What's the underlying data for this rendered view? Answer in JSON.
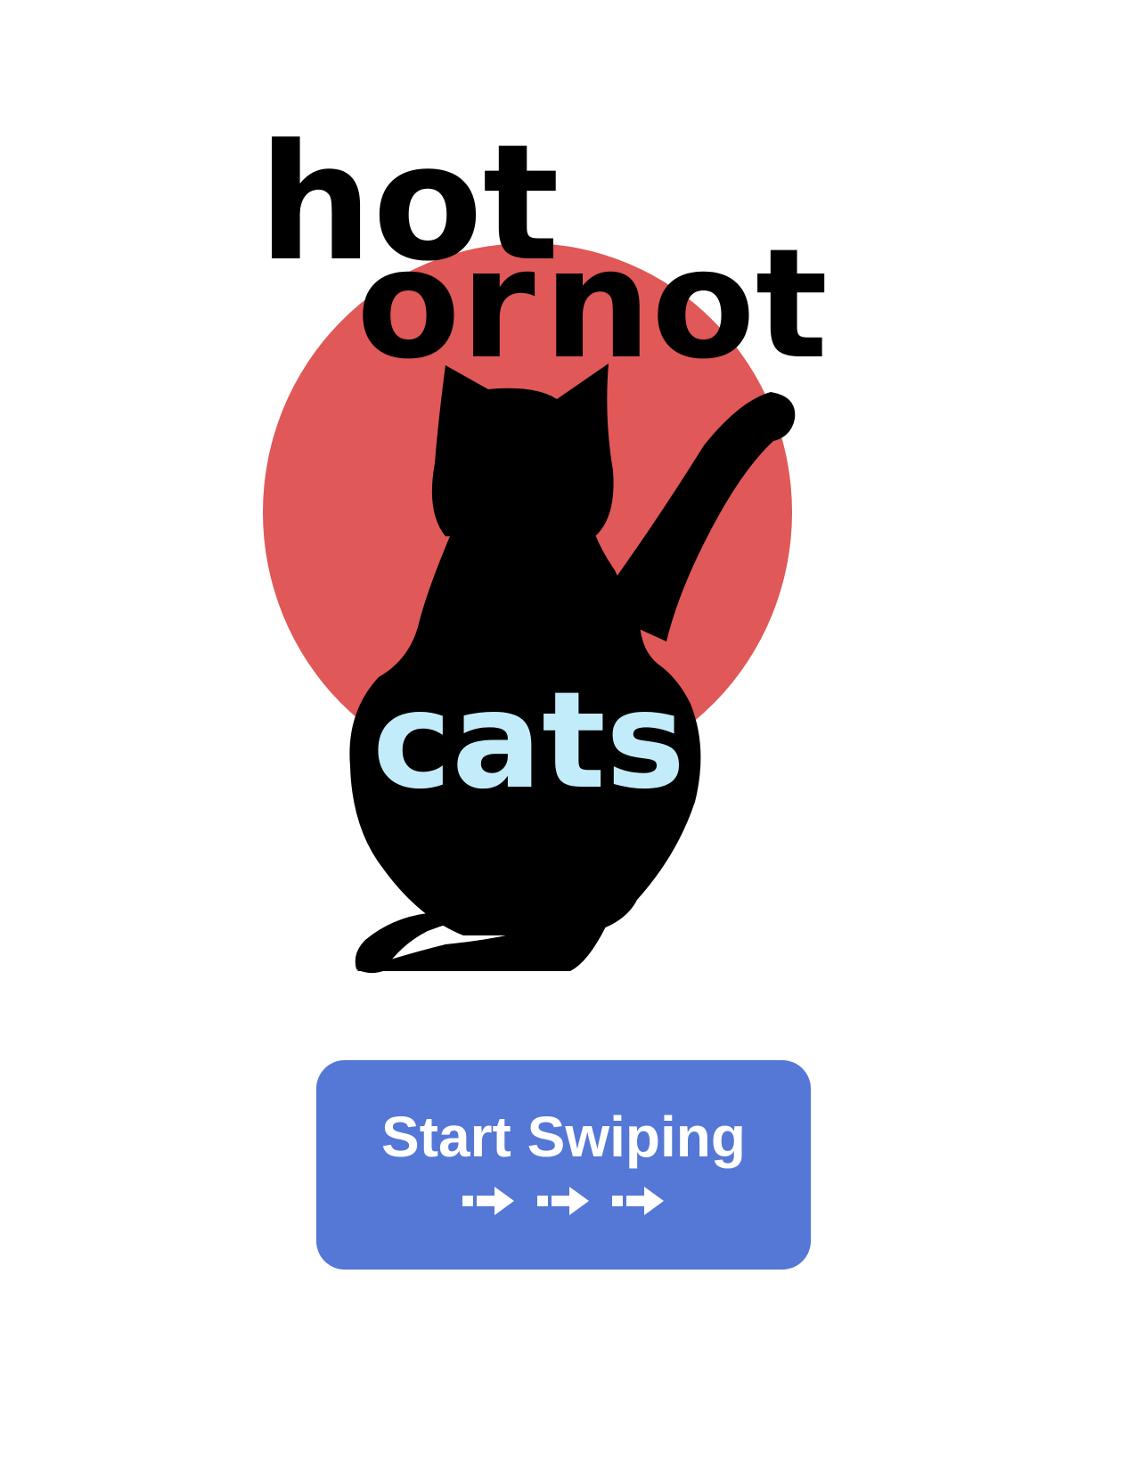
{
  "logo": {
    "word_hot": "hot",
    "word_or": "or",
    "word_not": "not",
    "word_cats": "cats",
    "circle_color": "#e05858",
    "cat_color": "#000000",
    "cats_text_color": "#c3ecfb"
  },
  "start_button": {
    "label": "Start Swiping",
    "color": "#5577d6",
    "arrow_icons": [
      "arrow-right-icon",
      "arrow-right-icon",
      "arrow-right-icon"
    ]
  }
}
